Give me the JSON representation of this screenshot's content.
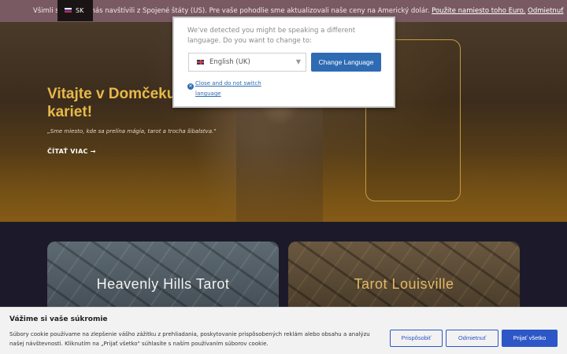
{
  "currency_notice": {
    "text": "Všimli si sme, že nás navštívili z Spojené štáty (US). Pre vaše pohodlie sme aktualizovali naše ceny na Americký dolár.",
    "link_euro": "Použite namiesto toho Euro.",
    "link_dismiss": "Odmietnuť"
  },
  "language_flag": {
    "label": "SK"
  },
  "language_popup": {
    "message": "We've detected you might be speaking a different language. Do you want to change to:",
    "selected_language": "English (UK)",
    "change_button": "Change Language",
    "close_link": "Close and do not switch language"
  },
  "hero": {
    "title": "Vitajte v Domčeku z kariet!",
    "quote": "„Sme miesto, kde sa prelína mágia, tarot a trocha šibalstva.\"",
    "read_more": "ČÍTAŤ VIAC →"
  },
  "cards": [
    {
      "title": "Heavenly Hills Tarot"
    },
    {
      "title": "Tarot Louisville"
    }
  ],
  "cookie_banner": {
    "title": "Vážime si vaše súkromie",
    "text": "Súbory cookie používame na zlepšenie vášho zážitku z prehliadania, poskytovanie prispôsobených reklám alebo obsahu a analýzu našej návštevnosti. Kliknutím na „Prijať všetko\" súhlasíte s naším používaním súborov cookie.",
    "customize": "Prispôsobiť",
    "reject": "Odmietnuť",
    "accept": "Prijať všetko"
  },
  "colors": {
    "accent_gold": "#e6b94a",
    "button_blue": "#2e6bb3",
    "cookie_blue": "#2d57c7",
    "notice_bg": "#7a5a62"
  }
}
